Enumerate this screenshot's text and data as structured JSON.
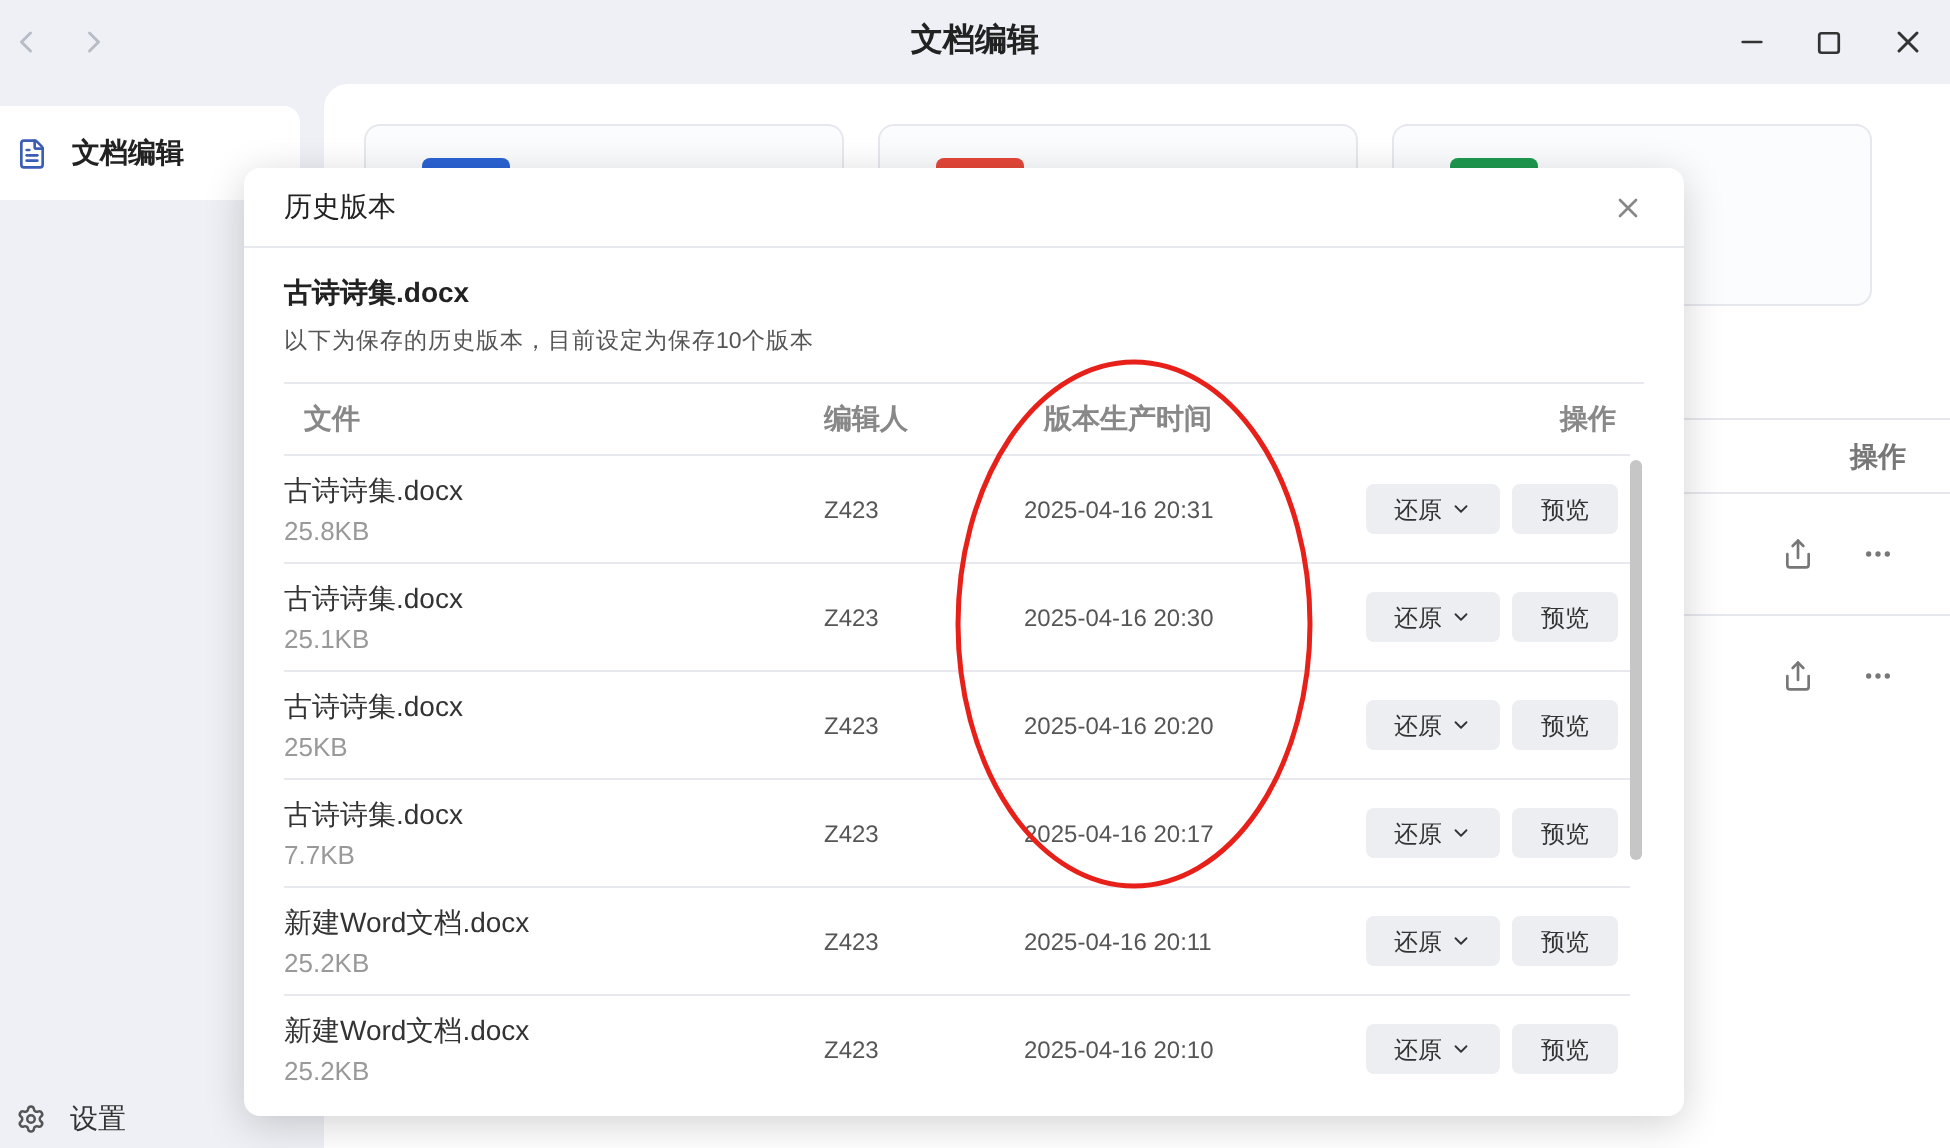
{
  "window": {
    "title": "文档编辑"
  },
  "sidebar": {
    "items": [
      {
        "label": "文档编辑",
        "selected": true
      }
    ],
    "settings": "设置"
  },
  "cards": [
    {
      "color": "#2a63d4"
    },
    {
      "color": "#e5473a"
    },
    {
      "color": "#1e9a4f"
    }
  ],
  "file_table": {
    "columns": [
      "操作"
    ],
    "rows": [
      {
        "kind": "file"
      },
      {
        "kind": "file"
      }
    ]
  },
  "dialog": {
    "title": "历史版本",
    "file_name": "古诗诗集.docx",
    "description": "以下为保存的历史版本，目前设定为保存10个版本",
    "columns": [
      "文件",
      "编辑人",
      "版本生产时间",
      "操作"
    ],
    "rows": [
      {
        "name": "古诗诗集.docx",
        "size": "25.8KB",
        "editor": "Z423",
        "time": "2025-04-16 20:31",
        "restore": "还原",
        "preview": "预览"
      },
      {
        "name": "古诗诗集.docx",
        "size": "25.1KB",
        "editor": "Z423",
        "time": "2025-04-16 20:30",
        "restore": "还原",
        "preview": "预览"
      },
      {
        "name": "古诗诗集.docx",
        "size": "25KB",
        "editor": "Z423",
        "time": "2025-04-16 20:20",
        "restore": "还原",
        "preview": "预览"
      },
      {
        "name": "古诗诗集.docx",
        "size": "7.7KB",
        "editor": "Z423",
        "time": "2025-04-16 20:17",
        "restore": "还原",
        "preview": "预览"
      },
      {
        "name": "新建Word文档.docx",
        "size": "25.2KB",
        "editor": "Z423",
        "time": "2025-04-16 20:11",
        "restore": "还原",
        "preview": "预览"
      },
      {
        "name": "新建Word文档.docx",
        "size": "25.2KB",
        "editor": "Z423",
        "time": "2025-04-16 20:10",
        "restore": "还原",
        "preview": "预览"
      }
    ]
  }
}
